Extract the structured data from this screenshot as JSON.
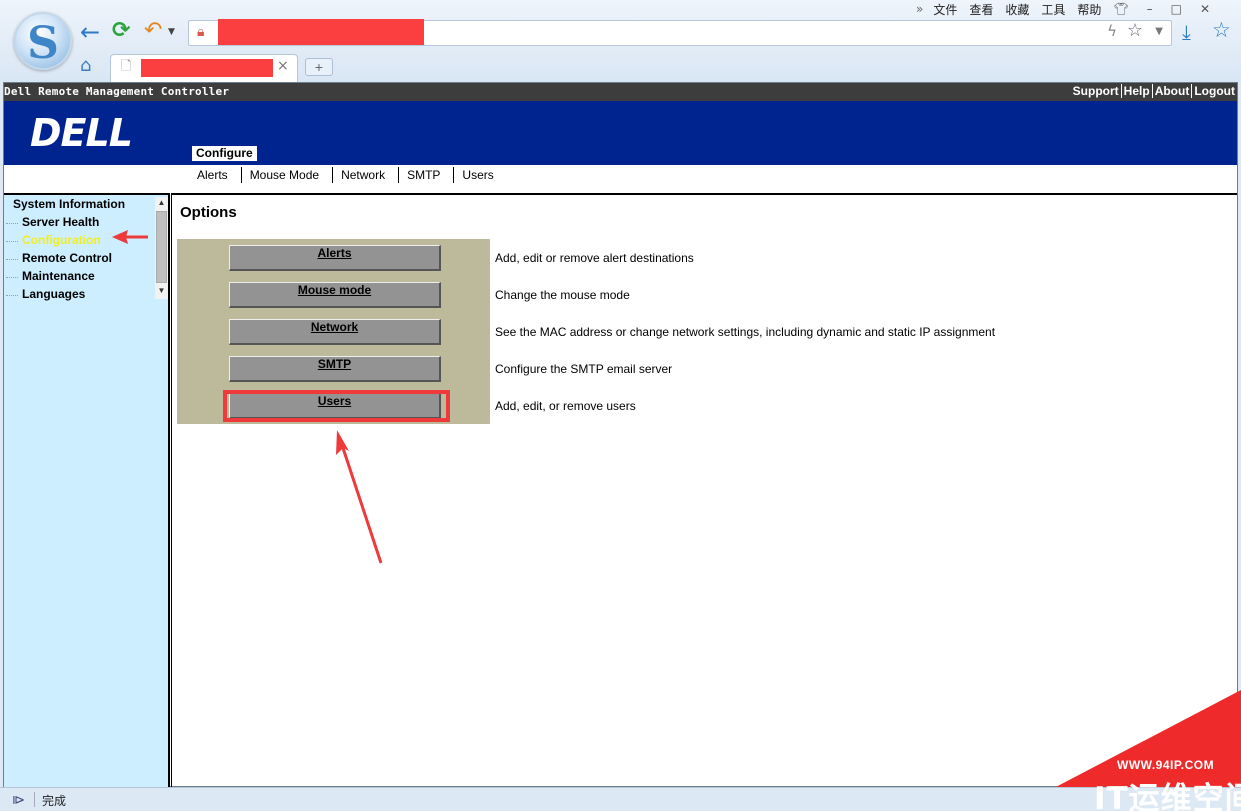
{
  "browser": {
    "logo_letter": "S",
    "menu": [
      "文件",
      "查看",
      "收藏",
      "工具",
      "帮助"
    ],
    "menu_more": "»",
    "status_text": "完成"
  },
  "drac": {
    "title": "Dell Remote Management Controller",
    "top_links": [
      "Support",
      "Help",
      "About",
      "Logout"
    ],
    "logo": "DELL",
    "active_tab": "Configure",
    "subnav": [
      "Alerts",
      "Mouse Mode",
      "Network",
      "SMTP",
      "Users"
    ]
  },
  "sidebar": {
    "items": [
      {
        "label": "System Information",
        "level": "root"
      },
      {
        "label": "Server Health",
        "level": "child"
      },
      {
        "label": "Configuration",
        "level": "child",
        "selected": true
      },
      {
        "label": "Remote Control",
        "level": "child"
      },
      {
        "label": "Maintenance",
        "level": "child"
      },
      {
        "label": "Languages",
        "level": "child"
      }
    ]
  },
  "content": {
    "heading": "Options",
    "options": [
      {
        "button": "Alerts",
        "description": "Add, edit or remove alert destinations"
      },
      {
        "button": "Mouse mode",
        "description": "Change the mouse mode"
      },
      {
        "button": "Network",
        "description": "See the MAC address or change network settings, including dynamic and static IP assignment"
      },
      {
        "button": "SMTP",
        "description": "Configure the SMTP email server"
      },
      {
        "button": "Users",
        "description": "Add, edit, or remove users"
      }
    ]
  },
  "watermark": {
    "url": "WWW.94IP.COM",
    "text": "IT运维空间"
  },
  "colors": {
    "banner": "#00248f",
    "sidebar_bg": "#cdeeff",
    "selected_item": "#f2ee20",
    "options_panel": "#bdb99b",
    "annotation_red": "#ee3a3a"
  }
}
